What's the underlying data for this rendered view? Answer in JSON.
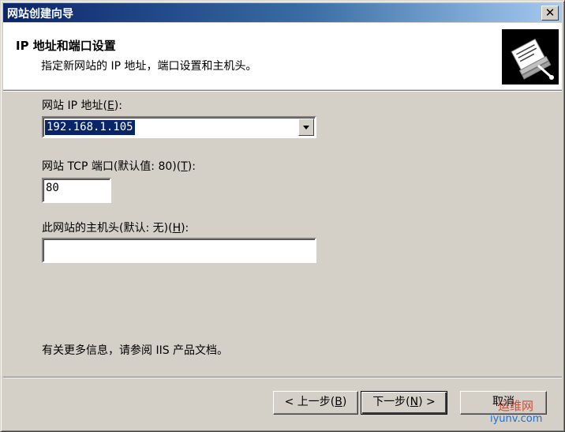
{
  "window": {
    "title": "网站创建向导",
    "close_glyph": "✕"
  },
  "header": {
    "title": "IP 地址和端口设置",
    "description": "指定新网站的 IP 地址，端口设置和主机头。",
    "icon": "wizard-document-icon"
  },
  "fields": {
    "ip": {
      "label_prefix": "网站 IP 地址(",
      "hotkey": "E",
      "label_suffix": "):",
      "value": "192.168.1.105"
    },
    "port": {
      "label_prefix": "网站 TCP 端口(默认值: 80)(",
      "hotkey": "T",
      "label_suffix": "):",
      "value": "80"
    },
    "host": {
      "label_prefix": "此网站的主机头(默认: 无)(",
      "hotkey": "H",
      "label_suffix": "):",
      "value": ""
    }
  },
  "info_text": "有关更多信息，请参阅 IIS 产品文档。",
  "buttons": {
    "back": {
      "prefix": "< 上一步(",
      "hotkey": "B",
      "suffix": ")"
    },
    "next": {
      "prefix": "下一步(",
      "hotkey": "N",
      "suffix": ") >"
    },
    "cancel": "取消"
  },
  "watermark": {
    "line1": "运维网",
    "line2": "iyunv.com"
  }
}
